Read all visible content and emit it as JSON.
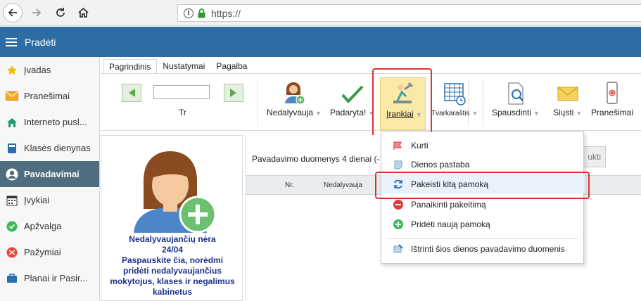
{
  "browser": {
    "url": "https://"
  },
  "header": {
    "title": "Pradėti"
  },
  "sidebar": {
    "items": [
      {
        "label": "Įvadas",
        "icon": "star-icon"
      },
      {
        "label": "Pranešimai",
        "icon": "envelope-icon"
      },
      {
        "label": "Interneto pusl...",
        "icon": "home-icon"
      },
      {
        "label": "Klasės dienynas",
        "icon": "book-icon"
      },
      {
        "label": "Pavadavimai",
        "icon": "person-icon",
        "active": true
      },
      {
        "label": "Įvykiai",
        "icon": "calendar-icon"
      },
      {
        "label": "Apžvalga",
        "icon": "check-circle-icon"
      },
      {
        "label": "Pažymiai",
        "icon": "grades-icon"
      },
      {
        "label": "Planai ir Pasir...",
        "icon": "briefcase-icon"
      }
    ]
  },
  "tabs": [
    {
      "label": "Pagrindinis",
      "active": true
    },
    {
      "label": "Nustatymai"
    },
    {
      "label": "Pagalba"
    }
  ],
  "ribbon": {
    "date_label": "Tr",
    "nedalyvauja": "Nedalyvauja",
    "padaryta": "Padaryta!",
    "irankiai": "Įrankiai",
    "tvarkarastis": "Tvarkaraštis",
    "spausdinti": "Spausdinti",
    "siusti": "Siųsti",
    "pranesimai": "Pranešimai"
  },
  "left_panel": {
    "line1": "Nedalyvaujančių nėra",
    "line2": "24/04",
    "line3": "Paspauskite čia, norėdmi",
    "line4": "pridėti nedalyvaujančius",
    "line5": "mokytojus, klases ir negalimus",
    "line6": "kabinetus"
  },
  "main": {
    "title": "Pavadavimo duomenys 4 dienai (-",
    "hidden_button": "ukti",
    "columns": [
      "Nr.",
      "Nedalyvauja"
    ]
  },
  "menu": {
    "items": [
      {
        "label": "Kurti",
        "icon": "flag-icon"
      },
      {
        "label": "Dienos pastaba",
        "icon": "note-icon"
      },
      {
        "label": "Pakeisti kitą pamoką",
        "icon": "swap-icon"
      },
      {
        "label": "Panaikinti pakeitimą",
        "icon": "minus-circle-icon"
      },
      {
        "label": "Pridėti naują pamoką",
        "icon": "plus-circle-icon"
      },
      {
        "label": "Ištrinti šios dienos pavadavimo duomenis",
        "icon": "erase-icon"
      }
    ]
  },
  "colors": {
    "header_bg": "#2e6da4",
    "active_side": "#4f6d7f",
    "highlight": "#e03030",
    "tools_bg": "#fbe9a6"
  }
}
